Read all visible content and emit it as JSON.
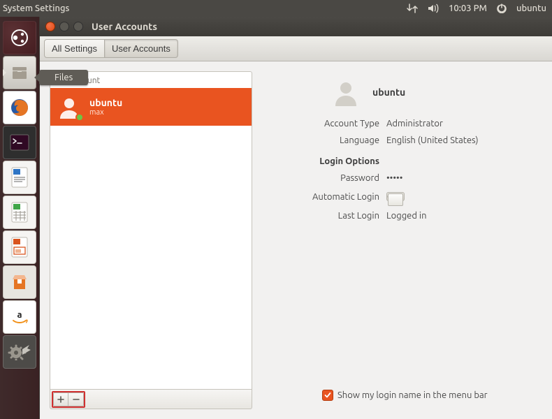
{
  "menubar": {
    "title": "System Settings",
    "time": "10:03 PM",
    "user": "ubuntu"
  },
  "launcher": {
    "tooltip": "Files"
  },
  "window": {
    "title": "User Accounts",
    "nav": {
      "all": "All Settings",
      "current": "User Accounts"
    }
  },
  "sidebar": {
    "section": "My Account",
    "items": [
      {
        "name": "ubuntu",
        "sub": "max"
      }
    ],
    "add_icon": "plus-icon",
    "remove_icon": "minus-icon"
  },
  "detail": {
    "name": "ubuntu",
    "account_type": {
      "label": "Account Type",
      "value": "Administrator"
    },
    "language": {
      "label": "Language",
      "value": "English (United States)"
    },
    "login_options_header": "Login Options",
    "password": {
      "label": "Password",
      "value": "•••••"
    },
    "autologin": {
      "label": "Automatic Login",
      "state": "OFF"
    },
    "last_login": {
      "label": "Last Login",
      "value": "Logged in"
    },
    "show_in_menubar": {
      "checked": true,
      "label": "Show my login name in the menu bar"
    }
  },
  "colors": {
    "accent": "#e95420"
  }
}
